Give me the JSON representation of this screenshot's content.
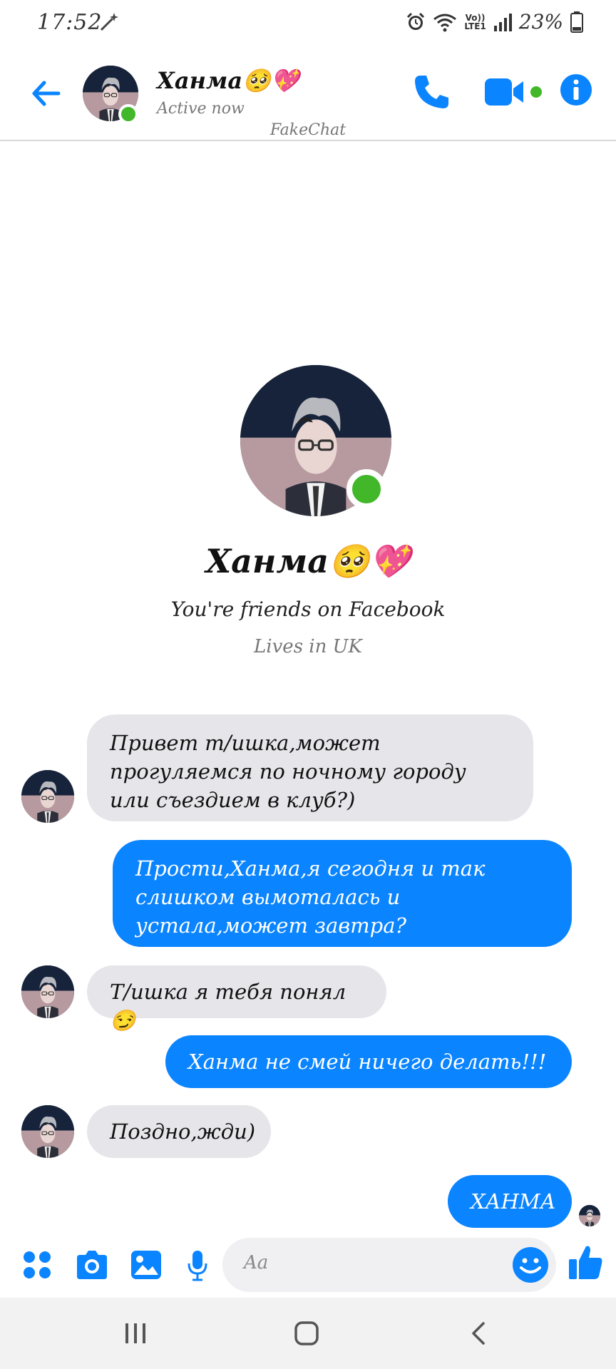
{
  "status_bar": {
    "time": "17:52",
    "lte_top": "Vo))",
    "lte_bottom": "LTE1",
    "battery": "23%"
  },
  "header": {
    "contact_name": "Ханма🥺💖",
    "status": "Active now",
    "watermark": "FakeChat",
    "icons": [
      "back-arrow-icon",
      "phone-icon",
      "video-camera-icon",
      "info-icon"
    ]
  },
  "profile": {
    "name": "Ханма🥺💖",
    "friends_line": "You're friends on Facebook",
    "lives_line": "Lives in UK"
  },
  "messages": [
    {
      "direction": "incoming",
      "text": "Привет т/ишка,может прогуляемся по ночному городу или съездием в клуб?)"
    },
    {
      "direction": "outgoing",
      "text": "Прости,Ханма,я сегодня и так слишком вымоталась и устала,может завтра?"
    },
    {
      "direction": "incoming",
      "text": "Т/ишка я тебя понял😏"
    },
    {
      "direction": "outgoing",
      "text": "Ханма не смей ничего делать!!!"
    },
    {
      "direction": "incoming",
      "text": "Поздно,жди)"
    },
    {
      "direction": "outgoing",
      "text": "ХАНМА"
    }
  ],
  "composer": {
    "placeholder": "Aa",
    "icons": [
      "apps-grid-icon",
      "camera-icon",
      "gallery-icon",
      "microphone-icon",
      "emoji-icon",
      "thumbs-up-icon"
    ]
  },
  "colors": {
    "accent": "#0a84ff",
    "online": "#42b72a",
    "incoming_bubble": "#e6e5ea"
  }
}
